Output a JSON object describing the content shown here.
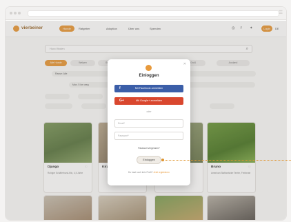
{
  "brand": {
    "name": "vierbeiner",
    "accent": "#e89a3c"
  },
  "nav": {
    "pill": "Hunde",
    "links": [
      "Ratgeber",
      "Adoption",
      "Über uns",
      "Spenden"
    ],
    "cta": "Login",
    "lang": "DE"
  },
  "search": {
    "placeholder": "Hund finden"
  },
  "filters": {
    "chips": [
      "Alle Hunde",
      "Welpen",
      "Senioren",
      "Klein",
      "Mittel",
      "Groß",
      "Ausland"
    ],
    "rows": [
      "Rasse: Alle",
      "Max. 5 km weg"
    ],
    "sort": "Sortieren nach: Neueste"
  },
  "cards": [
    {
      "name": "Django",
      "desc": "Ruhiger Schäferhund-Mix, 4,5 Jahre"
    },
    {
      "name": "Kira",
      "desc": ""
    },
    {
      "name": "",
      "desc": ""
    },
    {
      "name": "Bruno",
      "desc": "American Staffordshire Terrier, Freiheute"
    }
  ],
  "modal": {
    "title": "Einloggen",
    "facebook": "Mit Facebook anmelden",
    "google": "Mit Google+ anmelden",
    "or": "oder",
    "email_placeholder": "Email*",
    "password_placeholder": "Passwort*",
    "forgot": "Passwort vergessen?",
    "submit": "Einloggen",
    "note": "Du hast noch kein Profil?",
    "note_link": "Jetzt registrieren",
    "fb_color": "#3b5ea8",
    "google_color": "#d9472e"
  }
}
